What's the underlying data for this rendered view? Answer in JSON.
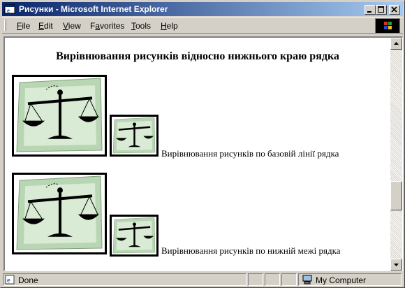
{
  "window": {
    "title": "Рисунки - Microsoft Internet Explorer"
  },
  "menu": {
    "items": [
      {
        "label_u": "F",
        "label_rest": "ile"
      },
      {
        "label_u": "E",
        "label_rest": "dit"
      },
      {
        "label_u": "V",
        "label_rest": "iew"
      },
      {
        "label_pre": "F",
        "label_u": "a",
        "label_rest": "vorites"
      },
      {
        "label_u": "T",
        "label_rest": "ools"
      },
      {
        "label_u": "H",
        "label_rest": "elp"
      }
    ]
  },
  "page": {
    "heading": "Вирівнювання рисунків відносно нижнього краю рядка",
    "rows": [
      {
        "caption": "Вирівнювання рисунків по базовій лінії рядка"
      },
      {
        "caption": "Вирівнювання рисунків по нижній межі рядка"
      }
    ],
    "image_icon": "scales-of-justice-icon"
  },
  "status": {
    "text": "Done",
    "zone": "My Computer"
  },
  "colors": {
    "title_start": "#0a246a",
    "title_end": "#a6caf0",
    "image_green": "#b9d6b4"
  }
}
